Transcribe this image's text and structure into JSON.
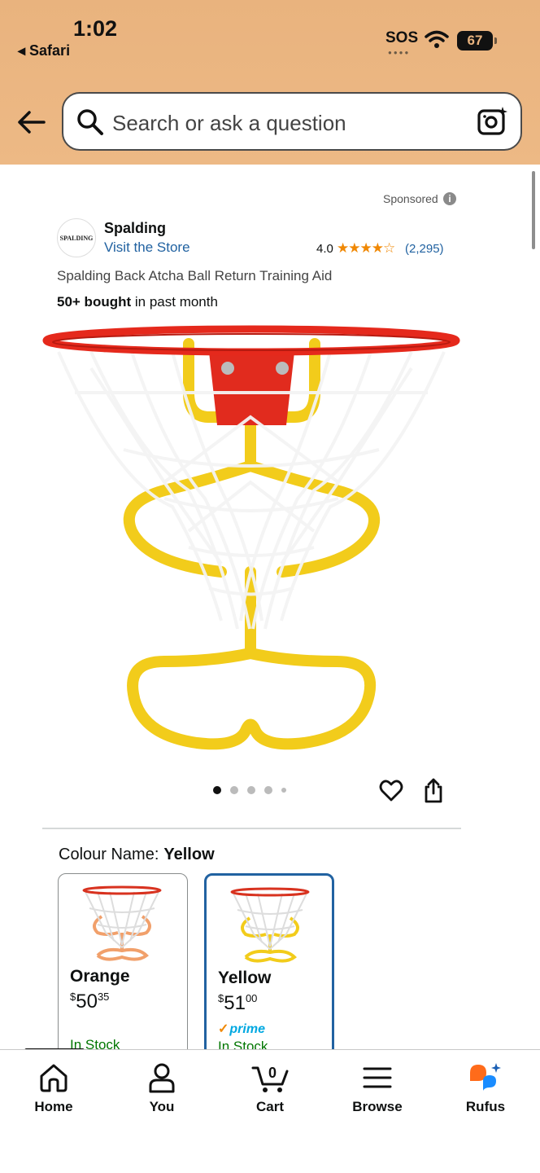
{
  "status_bar": {
    "time": "1:02",
    "back_app": "◂ Safari",
    "sos": "SOS",
    "battery": "67"
  },
  "search": {
    "placeholder": "Search or ask a question"
  },
  "ad": {
    "sponsored_label": "Sponsored",
    "brand_logo_text": "SPALDING",
    "brand_name": "Spalding",
    "visit_store": "Visit the Store",
    "rating": "4.0",
    "stars": "★★★★☆",
    "rating_count": "(2,295)"
  },
  "product": {
    "title": "Spalding Back Atcha Ball Return Training Aid",
    "bought_bold": "50+ bought",
    "bought_rest": " in past month",
    "image_count": 5,
    "active_image": 1
  },
  "colour": {
    "label": "Colour Name:",
    "selected": "Yellow",
    "variants": [
      {
        "name": "Orange",
        "price_dollars": "50",
        "price_cents": "35",
        "currency": "$",
        "stock": "In Stock",
        "prime": false
      },
      {
        "name": "Yellow",
        "price_dollars": "51",
        "price_cents": "00",
        "currency": "$",
        "stock": "In Stock",
        "prime": true,
        "prime_label": "prime"
      }
    ]
  },
  "nav": {
    "items": [
      {
        "label": "Home",
        "icon": "home-icon"
      },
      {
        "label": "You",
        "icon": "person-icon"
      },
      {
        "label": "Cart",
        "icon": "cart-icon",
        "count": "0"
      },
      {
        "label": "Browse",
        "icon": "menu-icon"
      },
      {
        "label": "Rufus",
        "icon": "rufus-icon"
      }
    ],
    "active": "Home"
  },
  "colors": {
    "header_bg": "#e9b37e",
    "link": "#2162a1",
    "star": "#f08804",
    "in_stock": "#007600",
    "prime": "#00a8e1",
    "selected_border": "#2162a1"
  }
}
